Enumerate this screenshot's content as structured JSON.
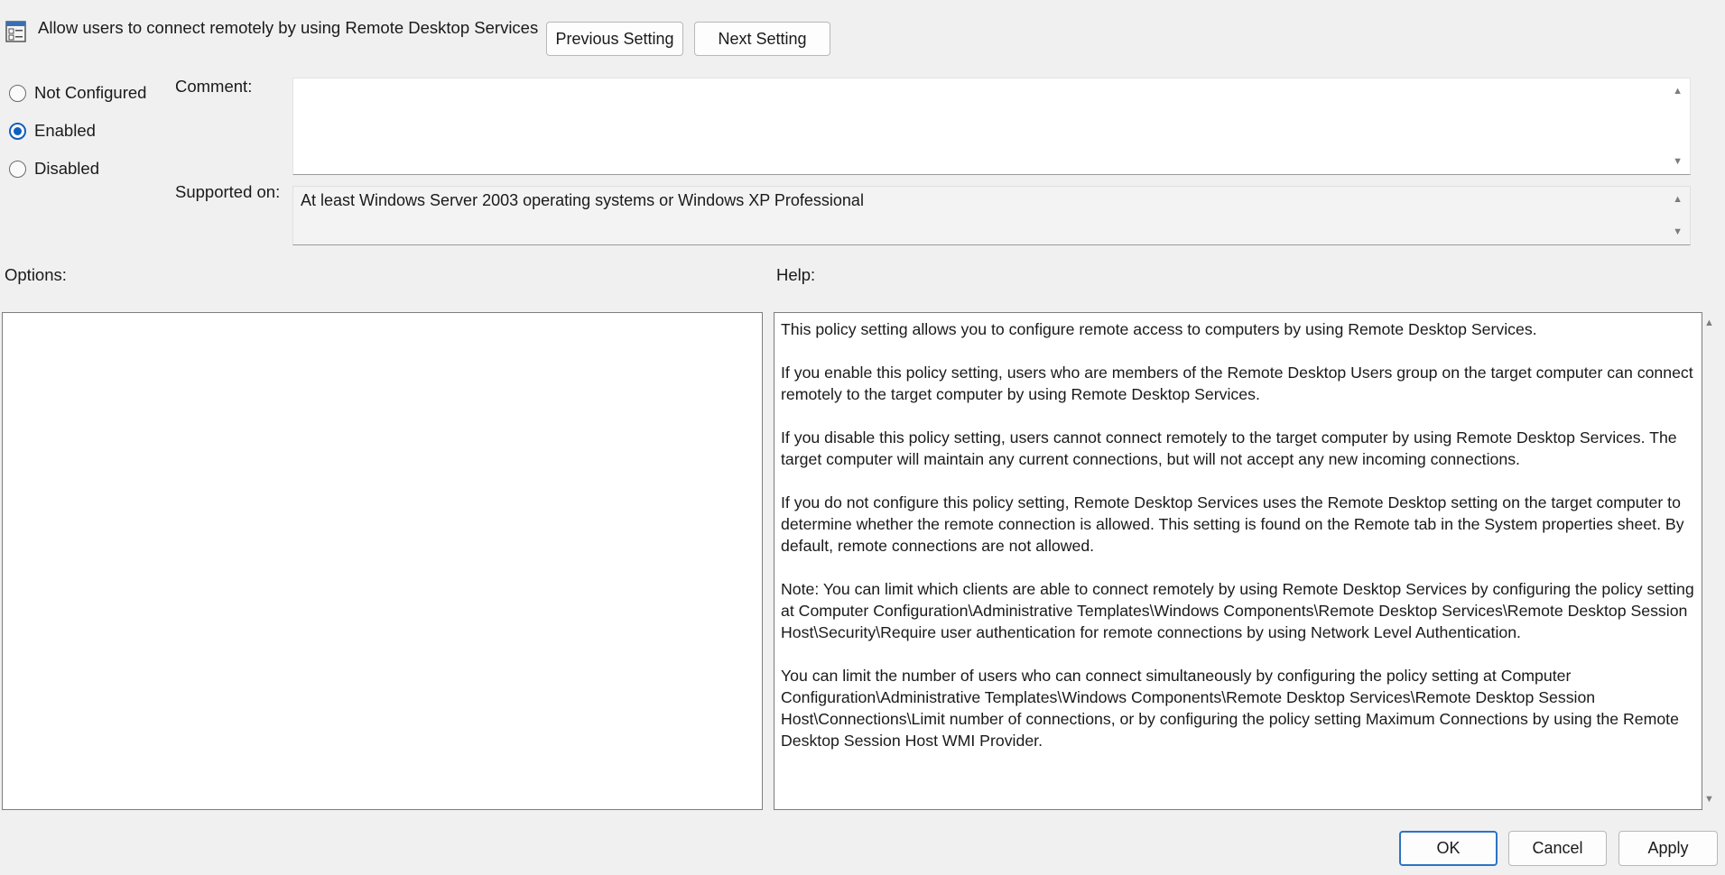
{
  "header": {
    "title": "Allow users to connect remotely by using Remote Desktop Services",
    "icon": "policy-setting-icon",
    "previous_label": "Previous Setting",
    "next_label": "Next Setting"
  },
  "state_options": [
    {
      "label": "Not Configured",
      "checked": false
    },
    {
      "label": "Enabled",
      "checked": true
    },
    {
      "label": "Disabled",
      "checked": false
    }
  ],
  "comment": {
    "label": "Comment:",
    "value": ""
  },
  "supported": {
    "label": "Supported on:",
    "value": "At least Windows Server 2003 operating systems or Windows XP Professional"
  },
  "options": {
    "label": "Options:"
  },
  "help": {
    "label": "Help:",
    "paragraphs": [
      "This policy setting allows you to configure remote access to computers by using Remote Desktop Services.",
      "If you enable this policy setting, users who are members of the Remote Desktop Users group on the target computer can connect remotely to the target computer by using Remote Desktop Services.",
      "If you disable this policy setting, users cannot connect remotely to the target computer by using Remote Desktop Services. The target computer will maintain any current connections, but will not accept any new incoming connections.",
      "If you do not configure this policy setting, Remote Desktop Services uses the Remote Desktop setting on the target computer to determine whether the remote connection is allowed. This setting is found on the Remote tab in the System properties sheet. By default, remote connections are not allowed.",
      "Note: You can limit which clients are able to connect remotely by using Remote Desktop Services by configuring the policy setting at Computer Configuration\\Administrative Templates\\Windows Components\\Remote Desktop Services\\Remote Desktop Session Host\\Security\\Require user authentication for remote connections by using Network Level Authentication.",
      "You can limit the number of users who can connect simultaneously by configuring the policy setting at Computer Configuration\\Administrative Templates\\Windows Components\\Remote Desktop Services\\Remote Desktop Session Host\\Connections\\Limit number of connections, or by configuring the policy setting Maximum Connections by using the Remote Desktop Session Host WMI Provider."
    ]
  },
  "footer": {
    "ok_label": "OK",
    "cancel_label": "Cancel",
    "apply_label": "Apply"
  },
  "colors": {
    "accent": "#0f5fbf",
    "background": "#f0f0f0"
  }
}
